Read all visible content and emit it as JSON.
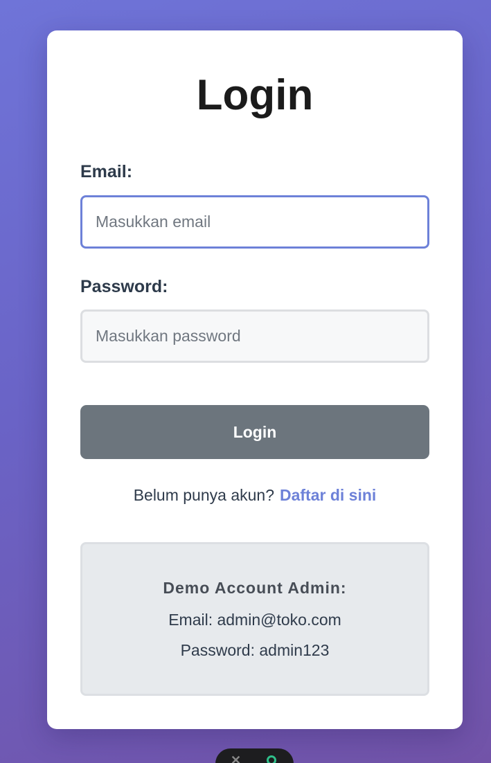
{
  "card": {
    "title": "Login"
  },
  "form": {
    "email": {
      "label": "Email:",
      "placeholder": "Masukkan email",
      "value": ""
    },
    "password": {
      "label": "Password:",
      "placeholder": "Masukkan password",
      "value": ""
    },
    "submit_label": "Login"
  },
  "register": {
    "prompt": "Belum punya akun?",
    "link_label": "Daftar di sini"
  },
  "demo": {
    "title": "Demo Account Admin:",
    "email_line": "Email: admin@toko.com",
    "password_line": "Password: admin123"
  },
  "floating_widget": {
    "icons": [
      "close-icon",
      "status-icon"
    ]
  },
  "colors": {
    "accent": "#6d81d8",
    "button": "#6c757d",
    "background_start": "#6f74d8",
    "background_end": "#7253a8"
  }
}
